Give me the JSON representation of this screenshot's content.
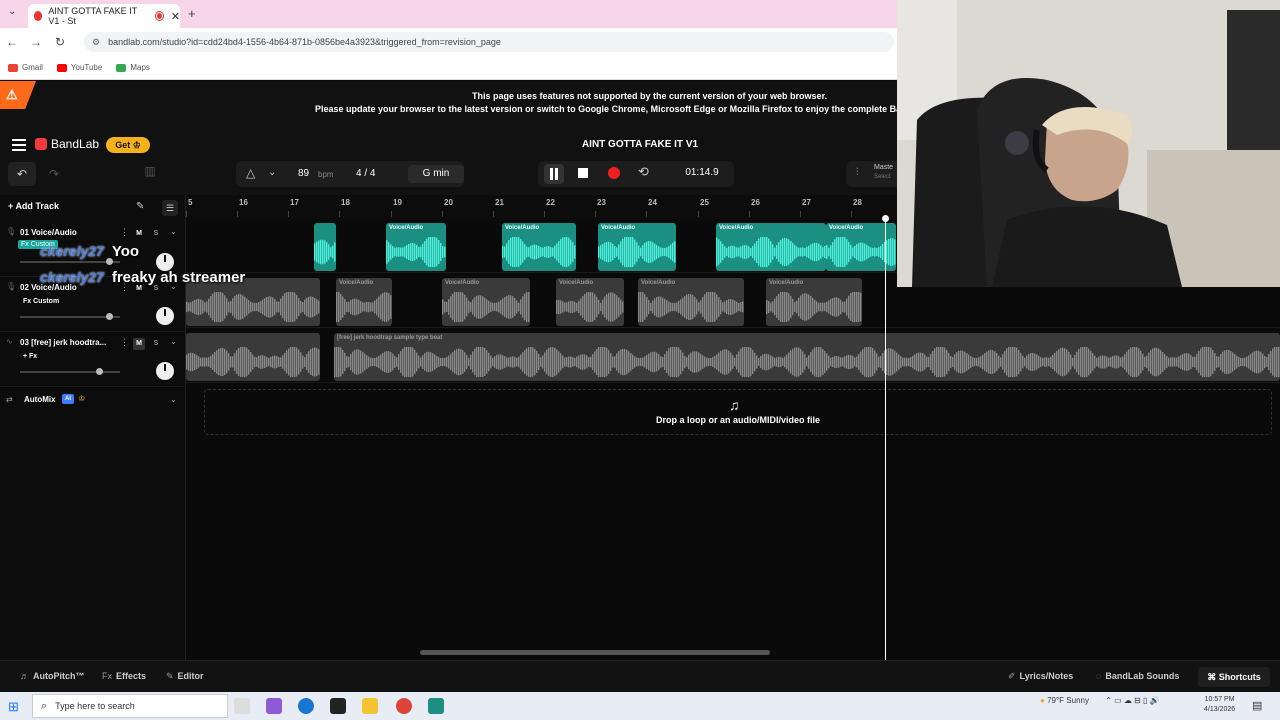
{
  "browser": {
    "tab_title": "AINT GOTTA FAKE IT V1 - St",
    "url": "bandlab.com/studio?id=cdd24bd4-1556-4b64-871b-0856be4a3923&triggered_from=revision_page",
    "bookmarks": [
      "Gmail",
      "YouTube",
      "Maps"
    ]
  },
  "banner": {
    "line1": "This page uses features not supported by the current version of your web browser.",
    "line2": "Please update your browser to the latest version or switch to Google Chrome, Microsoft Edge or Mozilla Firefox to enjoy the complete Ba"
  },
  "app": {
    "logo": "BandLab",
    "get_label": "Get",
    "project_title": "AINT GOTTA FAKE IT V1",
    "bpm": "89",
    "bpm_unit": "bpm",
    "time_signature": "4 / 4",
    "key": "G min",
    "timecode": "01:14.9",
    "master_label": "Maste",
    "master_sub": "Select"
  },
  "left_panel": {
    "add_track": "Add Track",
    "tracks": [
      {
        "name": "01 Voice/Audio",
        "fx": "Fx Custom",
        "m": "M",
        "s": "S",
        "volume": 0.82
      },
      {
        "name": "02 Voice/Audio",
        "fx": "Fx Custom",
        "m": "M",
        "s": "S",
        "volume": 0.82
      },
      {
        "name": "03 [free] jerk hoodtra...",
        "fx": "+ Fx",
        "m": "M",
        "s": "S",
        "volume": 0.72
      }
    ],
    "automix": "AutoMix",
    "ai_badge": "AI"
  },
  "ruler": [
    "5",
    "16",
    "17",
    "18",
    "19",
    "20",
    "21",
    "22",
    "23",
    "24",
    "25",
    "26",
    "27",
    "28"
  ],
  "clips": {
    "voice_label": "Voice/Audio",
    "beat_label": "[free] jerk hoodtrap sample type beat"
  },
  "dropzone": "Drop a loop or an audio/MIDI/video file",
  "bottom": {
    "autopitch": "AutoPitch™",
    "effects": "Effects",
    "editor": "Editor",
    "lyrics": "Lyrics/Notes",
    "sounds": "BandLab Sounds",
    "shortcuts": "Shortcuts"
  },
  "chat": [
    {
      "user": "ckerely27",
      "msg": "Yoo"
    },
    {
      "user": "ckerely27",
      "msg": "freaky ah streamer"
    }
  ],
  "taskbar": {
    "search_placeholder": "Type here to search",
    "weather": "79°F  Sunny",
    "time": "10:57 PM",
    "date": "4/13/2026"
  }
}
